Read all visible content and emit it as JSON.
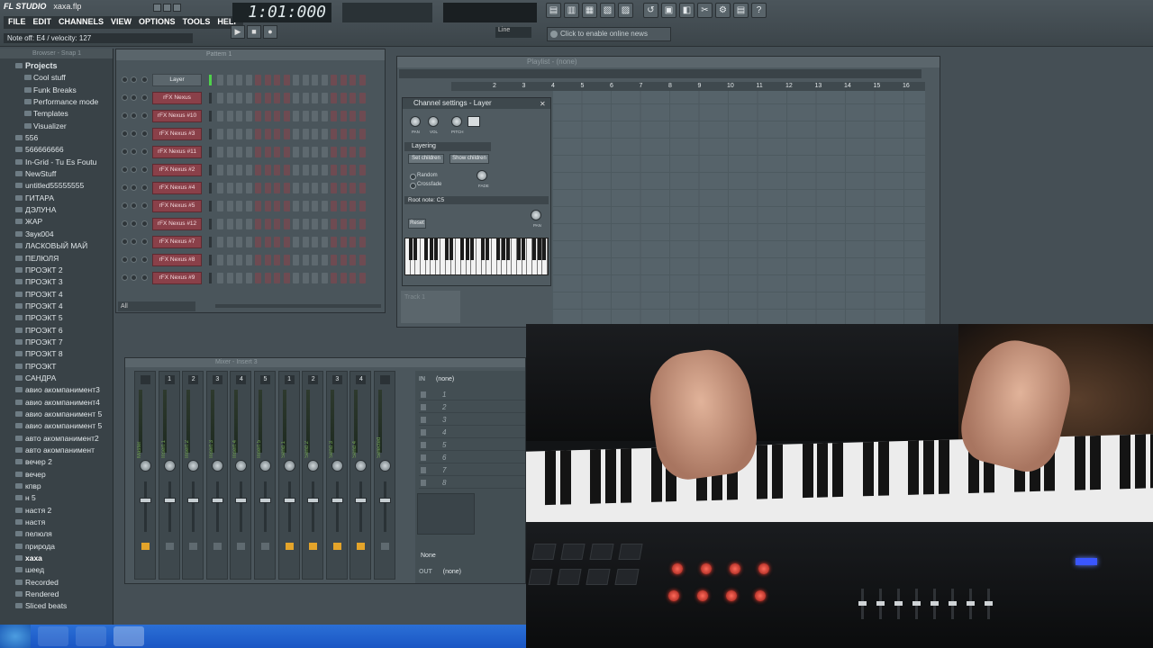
{
  "app": {
    "logo": "FL STUDIO",
    "file": "xaxa.flp"
  },
  "menu": [
    "FILE",
    "EDIT",
    "CHANNELS",
    "VIEW",
    "OPTIONS",
    "TOOLS",
    "HELP"
  ],
  "hint": "Note off: E4 / velocity: 127",
  "time_display": "1:01:000",
  "news": "Click to enable online news",
  "line_mode": "Line",
  "browser": {
    "title": "Browser - Snap 1",
    "items": [
      {
        "label": "Projects",
        "type": "top"
      },
      {
        "label": "Cool stuff",
        "type": "sub"
      },
      {
        "label": "Funk Breaks",
        "type": "sub"
      },
      {
        "label": "Performance mode",
        "type": "sub"
      },
      {
        "label": "Templates",
        "type": "sub"
      },
      {
        "label": "Visualizer",
        "type": "sub"
      },
      {
        "label": "556",
        "type": "item"
      },
      {
        "label": "566666666",
        "type": "item"
      },
      {
        "label": "In-Grid - Tu Es Foutu",
        "type": "item"
      },
      {
        "label": "NewStuff",
        "type": "item"
      },
      {
        "label": "untitled55555555",
        "type": "item"
      },
      {
        "label": "ГИТАРА",
        "type": "item"
      },
      {
        "label": "ДЭЛУНА",
        "type": "item"
      },
      {
        "label": "ЖАР",
        "type": "item"
      },
      {
        "label": "Звук004",
        "type": "item"
      },
      {
        "label": "ЛАСКОВЫЙ МАЙ",
        "type": "item"
      },
      {
        "label": "ПЕЛЮЛЯ",
        "type": "item"
      },
      {
        "label": "ПРОЭКТ 2",
        "type": "item"
      },
      {
        "label": "ПРОЭКТ 3",
        "type": "item"
      },
      {
        "label": "ПРОЭКТ 4",
        "type": "item"
      },
      {
        "label": "ПРОЭКТ 4",
        "type": "item"
      },
      {
        "label": "ПРОЭКТ 5",
        "type": "item"
      },
      {
        "label": "ПРОЭКТ 6",
        "type": "item"
      },
      {
        "label": "ПРОЭКТ 7",
        "type": "item"
      },
      {
        "label": "ПРОЭКТ 8",
        "type": "item"
      },
      {
        "label": "ПРОЭКТ",
        "type": "item"
      },
      {
        "label": "САНДРА",
        "type": "item"
      },
      {
        "label": "авио акомпанимент3",
        "type": "item"
      },
      {
        "label": "авио акомпанимент4",
        "type": "item"
      },
      {
        "label": "авио акомпанимент 5",
        "type": "item"
      },
      {
        "label": "авио акомпанимент 5",
        "type": "item"
      },
      {
        "label": "авто акомпанимент2",
        "type": "item"
      },
      {
        "label": "авто акомпанимент",
        "type": "item"
      },
      {
        "label": "вечер 2",
        "type": "item"
      },
      {
        "label": "вечер",
        "type": "item"
      },
      {
        "label": "кпвр",
        "type": "item"
      },
      {
        "label": "н 5",
        "type": "item"
      },
      {
        "label": "настя 2",
        "type": "item"
      },
      {
        "label": "настя",
        "type": "item"
      },
      {
        "label": "пелюля",
        "type": "item"
      },
      {
        "label": "природа",
        "type": "item"
      },
      {
        "label": "хаха",
        "type": "selected"
      },
      {
        "label": "шеед",
        "type": "item"
      },
      {
        "label": "Recorded",
        "type": "item"
      },
      {
        "label": "Rendered",
        "type": "item"
      },
      {
        "label": "Sliced beats",
        "type": "item"
      }
    ]
  },
  "stepseq": {
    "title": "Pattern 1",
    "filter": "All",
    "channels": [
      "Layer",
      "rFX Nexus",
      "rFX Nexus #10",
      "rFX Nexus #3",
      "rFX Nexus #11",
      "rFX Nexus #2",
      "rFX Nexus #4",
      "rFX Nexus #5",
      "rFX Nexus #12",
      "rFX Nexus #7",
      "rFX Nexus #8",
      "rFX Nexus #9"
    ]
  },
  "playlist": {
    "title": "Playlist - (none)",
    "ruler": [
      "2",
      "3",
      "4",
      "5",
      "6",
      "7",
      "8",
      "9",
      "10",
      "11",
      "12",
      "13",
      "14",
      "15",
      "16"
    ],
    "track": "Track 1"
  },
  "channel_settings": {
    "title": "Channel settings - Layer",
    "knobs": [
      "PAN",
      "VOL",
      "PITCH"
    ],
    "section": "Layering",
    "set_children": "Set children",
    "show_children": "Show children",
    "random": "Random",
    "crossfade": "Crossfade",
    "fade": "FADE",
    "root_note": "Root note: C5",
    "reset": "Reset",
    "pan_small": "PAN"
  },
  "mixer": {
    "title": "Mixer - Insert 3",
    "strips": [
      {
        "num": "",
        "label": "Master",
        "on": true
      },
      {
        "num": "1",
        "label": "Insert 1",
        "on": false
      },
      {
        "num": "2",
        "label": "Insert 2",
        "on": false
      },
      {
        "num": "3",
        "label": "Insert 3",
        "on": false
      },
      {
        "num": "4",
        "label": "Insert 4",
        "on": false
      },
      {
        "num": "5",
        "label": "Insert 5",
        "on": false
      },
      {
        "num": "1",
        "label": "Send 1",
        "on": true
      },
      {
        "num": "2",
        "label": "Send 2",
        "on": true
      },
      {
        "num": "3",
        "label": "Send 3",
        "on": true
      },
      {
        "num": "4",
        "label": "Send 4",
        "on": true
      },
      {
        "num": "",
        "label": "Selected",
        "on": false
      }
    ],
    "in_label": "IN",
    "in_value": "(none)",
    "fx_slots": [
      "1",
      "2",
      "3",
      "4",
      "5",
      "6",
      "7",
      "8"
    ],
    "none_label": "None",
    "out_label": "OUT",
    "out_value": "(none)"
  }
}
